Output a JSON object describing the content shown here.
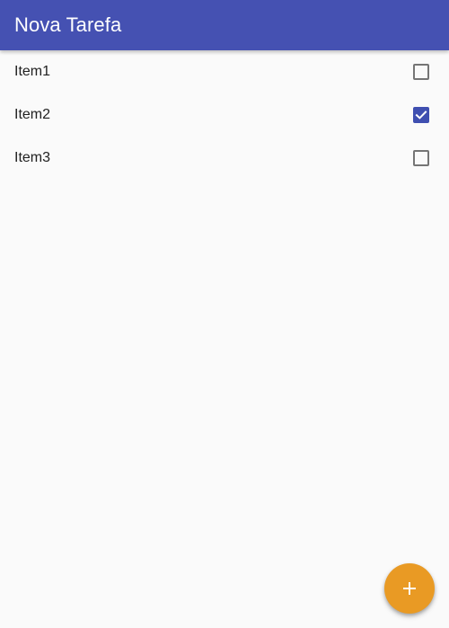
{
  "app_bar": {
    "title": "Nova Tarefa",
    "color": "#4551b2"
  },
  "tasks": [
    {
      "label": "Item1",
      "checked": false
    },
    {
      "label": "Item2",
      "checked": true
    },
    {
      "label": "Item3",
      "checked": false
    }
  ],
  "fab": {
    "icon": "plus-icon",
    "color": "#e99a24"
  },
  "checkbox_colors": {
    "checked": "#3f4fb0",
    "unchecked_border": "#757575"
  }
}
